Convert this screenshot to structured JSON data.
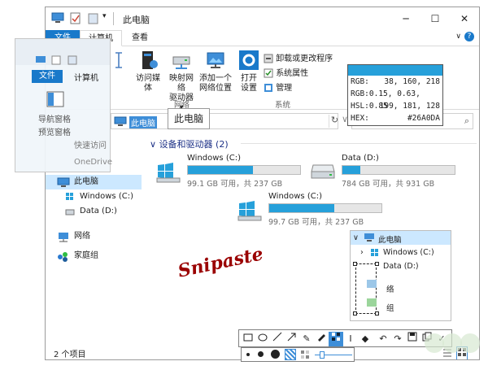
{
  "window": {
    "title": "此电脑",
    "min_icon": "minimize-icon",
    "max_icon": "maximize-icon",
    "close_icon": "close-icon"
  },
  "ribbon": {
    "tabs": [
      "文件",
      "计算机",
      "查看"
    ],
    "buttons": {
      "access_media": "访问媒体",
      "map_drive_1": "映射网络",
      "map_drive_2": "驱动器",
      "add_location_1": "添加一个",
      "add_location_2": "网络位置",
      "open_settings_1": "打开",
      "open_settings_2": "设置",
      "uninstall": "卸载或更改程序",
      "sys_props": "系统属性",
      "manage": "管理"
    },
    "groups": {
      "network": "网络",
      "system": "系统"
    }
  },
  "address": {
    "text": "此电脑"
  },
  "tooltip": "此电脑",
  "nav": {
    "items": [
      "此电脑",
      "Windows (C:)",
      "Data (D:)",
      "网络",
      "家庭组"
    ]
  },
  "ghost": {
    "tabs": [
      "文件",
      "计算机"
    ],
    "labels": [
      "导航窗格",
      "预览窗格",
      "快速访问",
      "OneDrive"
    ]
  },
  "section_title": "设备和驱动器 (2)",
  "drives": [
    {
      "name": "Windows (C:)",
      "size": "99.1 GB 可用，共 237 GB",
      "used": 0.58
    },
    {
      "name": "Data (D:)",
      "size": "784 GB 可用，共 931 GB",
      "used": 0.16
    },
    {
      "name": "Windows (C:)",
      "size": "99.7 GB 可用，共 237 GB",
      "used": 0.58
    }
  ],
  "picker": {
    "color": "#26A0DA",
    "rows": [
      {
        "k": "RGB:",
        "v": "38, 160, 218"
      },
      {
        "k": "RGB:",
        "v": "0.15, 0.63, 0.85"
      },
      {
        "k": "HSL:",
        "v": "199, 181, 128"
      },
      {
        "k": "HEX:",
        "v": "#26A0DA"
      }
    ]
  },
  "tree": {
    "root": "此电脑",
    "child1": "Windows (C:)",
    "child2": "Data (D:)",
    "child3": "络",
    "child4": "组"
  },
  "snipaste": "Snipaste",
  "status": "2 个项目",
  "colors": {
    "accent": "#1979ca",
    "bar": "#26a0da",
    "picked": "#26A0DA"
  }
}
